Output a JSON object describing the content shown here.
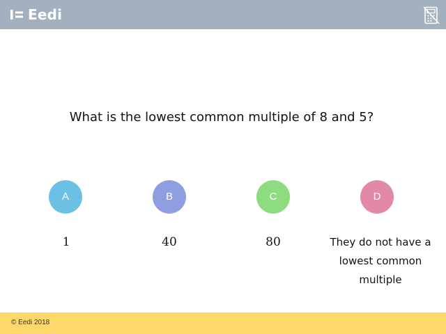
{
  "header": {
    "brand": "Eedi",
    "logo_icon": "eedi-logo-icon",
    "calculator_icon": "calculator-disabled-icon",
    "background_color": "#a3b1bf"
  },
  "question": {
    "text": "What is the lowest common multiple of 8 and 5?"
  },
  "choices": [
    {
      "letter": "A",
      "answer": "1",
      "color": "#6cc0e3"
    },
    {
      "letter": "B",
      "answer": "40",
      "color": "#8f9ee0"
    },
    {
      "letter": "C",
      "answer": "80",
      "color": "#8ddc80"
    },
    {
      "letter": "D",
      "answer": "They do not have a lowest common multiple",
      "color": "#e289a8"
    }
  ],
  "footer": {
    "copyright": "© Eedi 2018",
    "background_color": "#fed86a"
  }
}
